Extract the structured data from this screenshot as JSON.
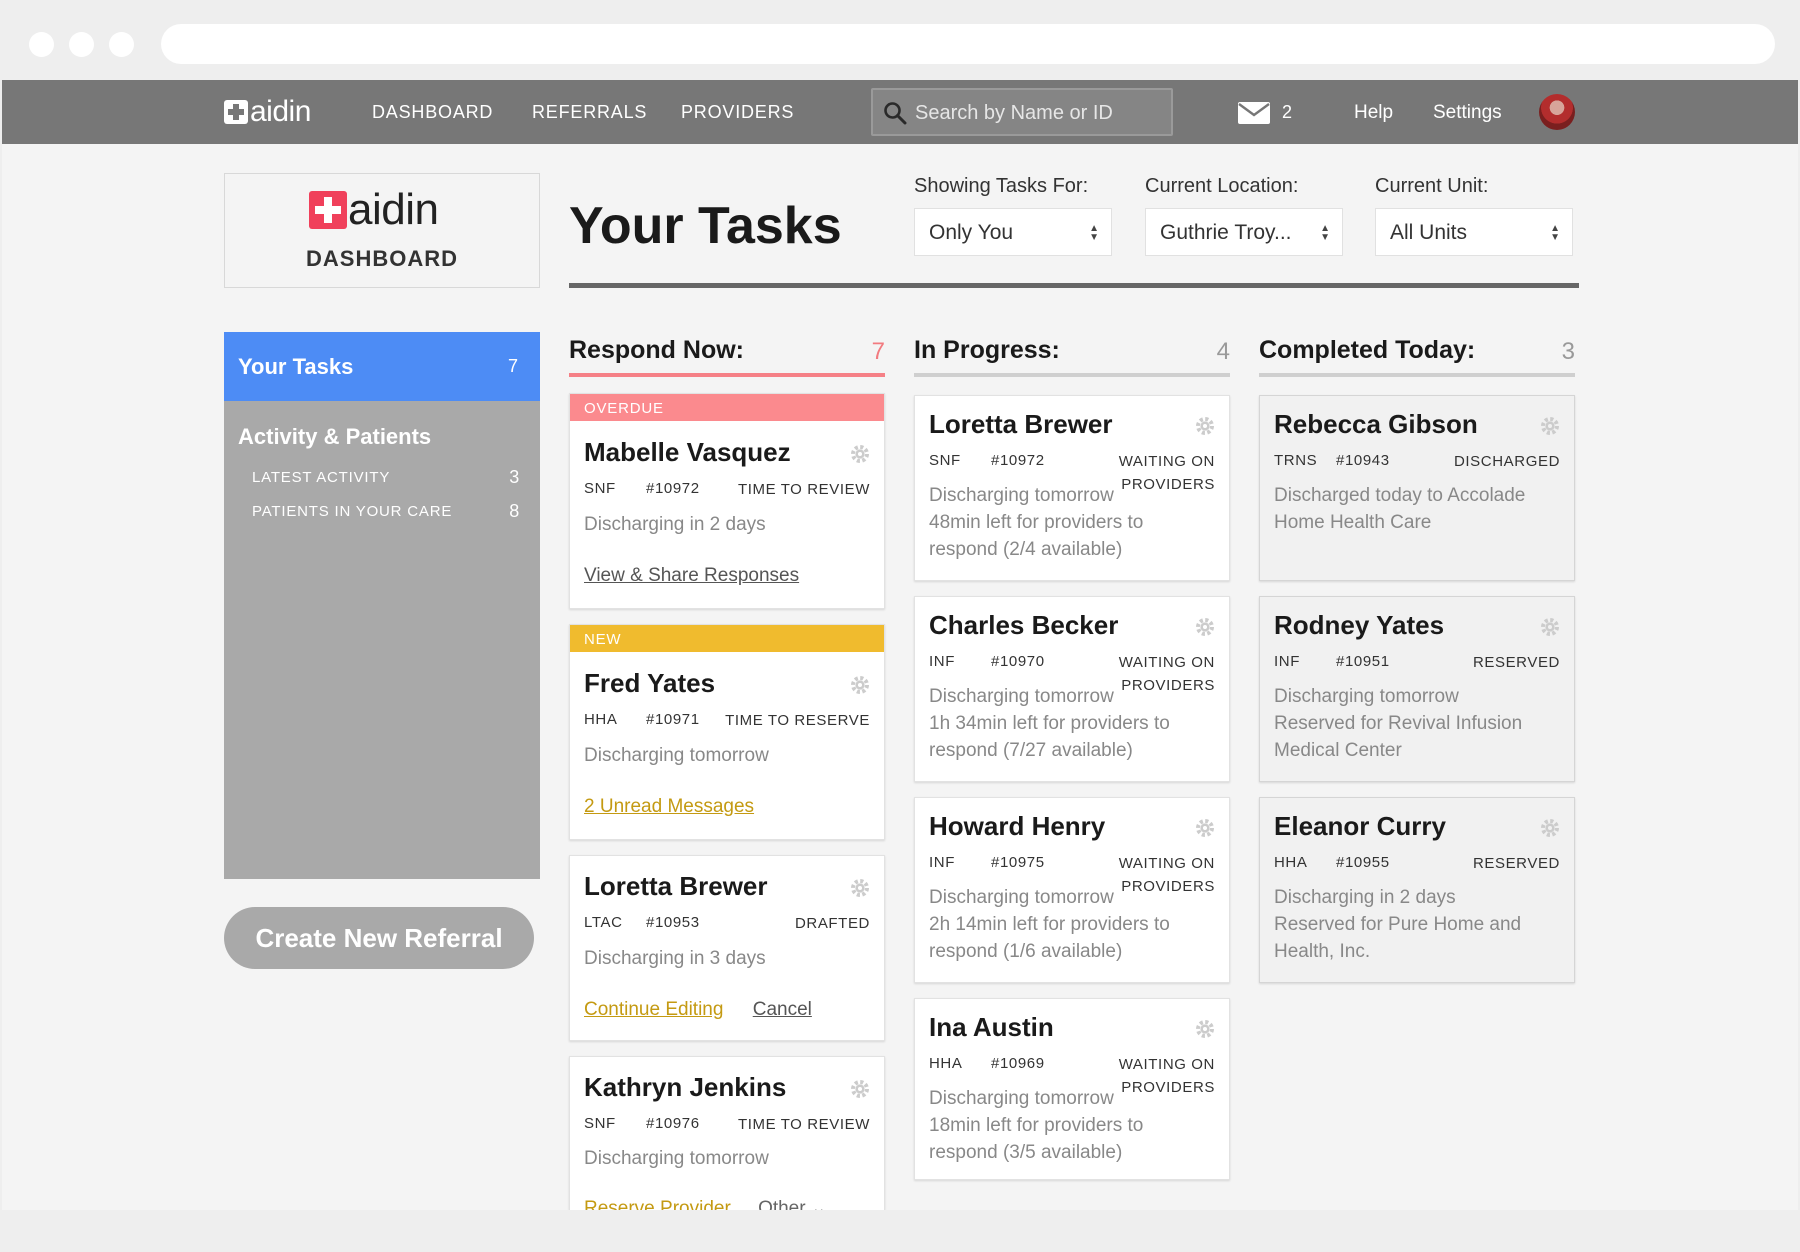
{
  "nav": {
    "logo": "aidin",
    "links": [
      "DASHBOARD",
      "REFERRALS",
      "PROVIDERS"
    ],
    "search_placeholder": "Search by Name or ID",
    "message_count": "2",
    "help": "Help",
    "settings": "Settings"
  },
  "logo_card": {
    "logo": "aidin",
    "subtitle": "DASHBOARD"
  },
  "sidebar": {
    "active": {
      "label": "Your Tasks",
      "count": "7"
    },
    "section": "Activity & Patients",
    "items": [
      {
        "label": "LATEST ACTIVITY",
        "count": "3"
      },
      {
        "label": "PATIENTS IN YOUR CARE",
        "count": "8"
      }
    ],
    "create_button": "Create New Referral"
  },
  "header": {
    "title": "Your Tasks",
    "filters": [
      {
        "label": "Showing Tasks For:",
        "value": "Only You"
      },
      {
        "label": "Current Location:",
        "value": "Guthrie Troy..."
      },
      {
        "label": "Current Unit:",
        "value": "All Units"
      }
    ]
  },
  "columns": [
    {
      "title": "Respond Now:",
      "count": "7",
      "cards": [
        {
          "banner": "OVERDUE",
          "name": "Mabelle Vasquez",
          "type": "SNF",
          "id": "#10972",
          "status": [
            "TIME TO REVIEW"
          ],
          "desc": [
            "Discharging in 2 days"
          ],
          "links": [
            "View & Share Responses"
          ]
        },
        {
          "banner": "NEW",
          "name": "Fred Yates",
          "type": "HHA",
          "id": "#10971",
          "status": [
            "TIME TO RESERVE"
          ],
          "desc": [
            "Discharging tomorrow"
          ],
          "links": [
            "2 Unread Messages"
          ]
        },
        {
          "name": "Loretta Brewer",
          "type": "LTAC",
          "id": "#10953",
          "status": [
            "DRAFTED"
          ],
          "desc": [
            "Discharging in 3 days"
          ],
          "links": [
            "Continue Editing",
            "Cancel"
          ]
        },
        {
          "name": "Kathryn Jenkins",
          "type": "SNF",
          "id": "#10976",
          "status": [
            "TIME TO REVIEW"
          ],
          "desc": [
            "Discharging tomorrow"
          ],
          "links": [
            "Reserve Provider",
            "Other"
          ]
        }
      ]
    },
    {
      "title": "In Progress:",
      "count": "4",
      "cards": [
        {
          "name": "Loretta Brewer",
          "type": "SNF",
          "id": "#10972",
          "status": [
            "WAITING ON",
            "PROVIDERS"
          ],
          "desc": [
            "Discharging tomorrow",
            "48min left for providers to",
            "respond (2/4 available)"
          ]
        },
        {
          "name": "Charles Becker",
          "type": "INF",
          "id": "#10970",
          "status": [
            "WAITING ON",
            "PROVIDERS"
          ],
          "desc": [
            "Discharging tomorrow",
            "1h 34min left for providers to",
            "respond (7/27 available)"
          ]
        },
        {
          "name": "Howard Henry",
          "type": "INF",
          "id": "#10975",
          "status": [
            "WAITING ON",
            "PROVIDERS"
          ],
          "desc": [
            "Discharging tomorrow",
            "2h 14min left for providers to",
            "respond (1/6 available)"
          ]
        },
        {
          "name": "Ina Austin",
          "type": "HHA",
          "id": "#10969",
          "status": [
            "WAITING ON",
            "PROVIDERS"
          ],
          "desc": [
            "Discharging tomorrow",
            "18min left for providers to",
            "respond (3/5 available)"
          ]
        }
      ]
    },
    {
      "title": "Completed Today:",
      "count": "3",
      "cards": [
        {
          "name": "Rebecca Gibson",
          "type": "TRNS",
          "id": "#10943",
          "status": [
            "DISCHARGED"
          ],
          "desc": [
            "Discharged today to Accolade",
            "Home Health Care"
          ]
        },
        {
          "name": "Rodney Yates",
          "type": "INF",
          "id": "#10951",
          "status": [
            "RESERVED"
          ],
          "desc": [
            "Discharging tomorrow",
            "Reserved for Revival Infusion",
            "Medical Center"
          ]
        },
        {
          "name": "Eleanor Curry",
          "type": "HHA",
          "id": "#10955",
          "status": [
            "RESERVED"
          ],
          "desc": [
            "Discharging in 2 days",
            "Reserved for Pure Home and",
            "Health, Inc."
          ]
        }
      ]
    }
  ],
  "colors": {
    "nav_bg": "#777777",
    "accent_blue": "#4d8cf5",
    "overdue": "#fb8a8e",
    "new": "#f0bb2e",
    "brand_red": "#f0405b",
    "link_yellow": "#c49a12"
  },
  "icons": [
    "search-icon",
    "mail-icon",
    "gear-icon",
    "select-arrows-icon",
    "chevron-down-icon"
  ]
}
